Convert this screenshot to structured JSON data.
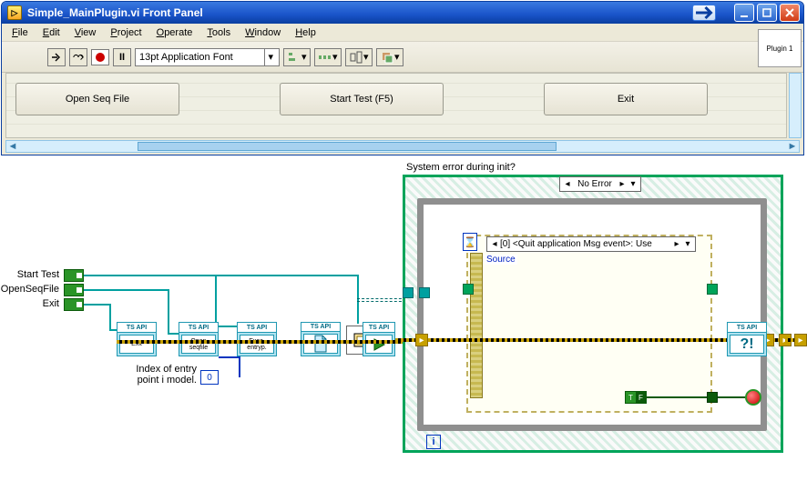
{
  "window": {
    "title": "Simple_MainPlugin.vi Front Panel",
    "plugin_label": "Plugin 1"
  },
  "menu": {
    "file": "File",
    "edit": "Edit",
    "view": "View",
    "project": "Project",
    "operate": "Operate",
    "tools": "Tools",
    "window": "Window",
    "help": "Help"
  },
  "toolbar": {
    "font": "13pt Application Font",
    "help": "?"
  },
  "panel": {
    "btn1": "Open Seq File",
    "btn2": "Start Test (F5)",
    "btn3": "Exit"
  },
  "diagram": {
    "terminals": {
      "start": "Start Test",
      "open": "OpenSeqFile",
      "exit": "Exit"
    },
    "idx_label": "Index of entry\npoint i model.",
    "idx_value": "0",
    "case_title": "System error during init?",
    "case_selector": "No Error",
    "event_selector": "[0] <Quit application Msg event>: Use",
    "source_label": "Source",
    "nodes": {
      "n1": "Exit",
      "n2": "Open\nseqfile",
      "n3": "Exec.\nentryp.",
      "q": "?!"
    },
    "tsapi": "TS API"
  }
}
